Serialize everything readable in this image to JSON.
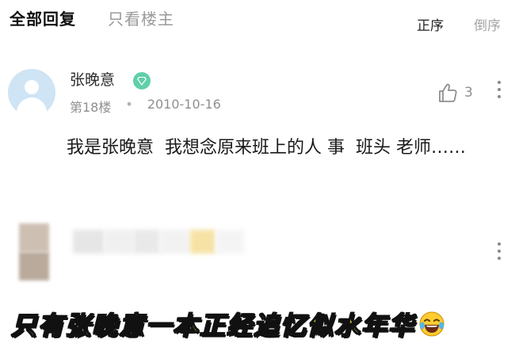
{
  "tabs": {
    "all_replies": "全部回复",
    "owner_only": "只看楼主"
  },
  "sort": {
    "ascending": "正序",
    "descending": "倒序"
  },
  "post": {
    "username": "张晚意",
    "badge_icon": "diamond-icon",
    "floor": "第18楼",
    "separator": "•",
    "date": "2010-10-16",
    "likes": "3",
    "content": "我是张晚意  我想念原来班上的人 事  班头 老师……"
  },
  "caption": {
    "text": "只有张晚意一本正经追忆似水年华",
    "emoji": "laughing-tears-emoji"
  },
  "colors": {
    "caption_fill": "#f6e63a",
    "badge": "#5fd0a9",
    "avatar_bg": "#cfe4f4"
  }
}
